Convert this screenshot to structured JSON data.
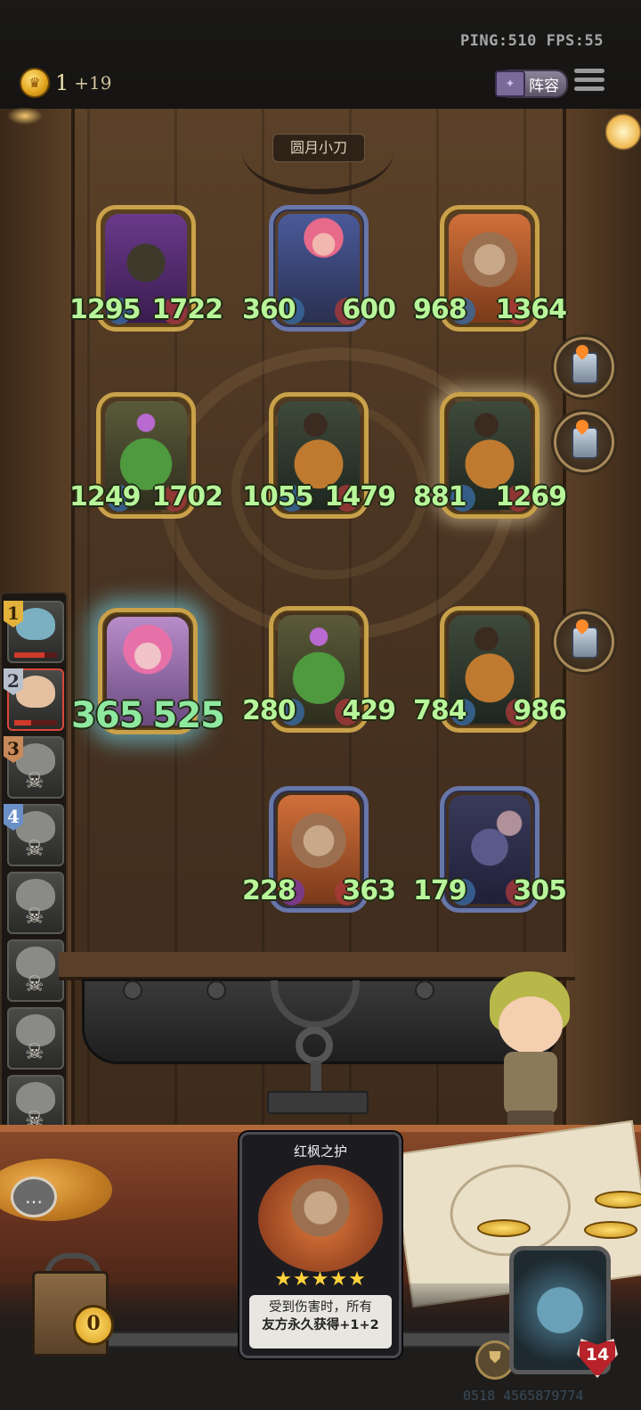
{
  "hud": {
    "ping": "PING:510",
    "fps": "FPS:55",
    "coins": "1",
    "coin_gain": "+19",
    "lineup_label": "阵容"
  },
  "opponent": {
    "name": "圆月小刀"
  },
  "board": {
    "units": [
      {
        "atk": "1295",
        "hp": "1722",
        "portrait": "dark-stump"
      },
      {
        "atk": "360",
        "hp": "600",
        "portrait": "armored-knight"
      },
      {
        "atk": "968",
        "hp": "1364",
        "portrait": "maple-treant"
      },
      {
        "atk": "1249",
        "hp": "1702",
        "portrait": "cactus"
      },
      {
        "atk": "1055",
        "hp": "1479",
        "portrait": "pumpkin"
      },
      {
        "atk": "881",
        "hp": "1269",
        "portrait": "pumpkin"
      },
      {
        "atk": "365",
        "hp": "525",
        "portrait": "pink-girl"
      },
      {
        "atk": "280",
        "hp": "429",
        "portrait": "cactus"
      },
      {
        "atk": "784",
        "hp": "986",
        "portrait": "pumpkin"
      },
      {
        "atk": "228",
        "hp": "363",
        "portrait": "maple-treant"
      },
      {
        "atk": "179",
        "hp": "305",
        "portrait": "rat"
      }
    ]
  },
  "roster": {
    "ranks": [
      "1",
      "2",
      "3",
      "4"
    ]
  },
  "card": {
    "title": "红枫之护",
    "stars": "★★★★★",
    "desc_line1": "受到伤害时，所有",
    "desc_line2": "友方永久获得+1+2"
  },
  "chest": {
    "count": "0"
  },
  "hero": {
    "hp": "14"
  },
  "footer": {
    "id": "0518 4565879774"
  },
  "colors": {
    "stat_text": "#b8f59a",
    "gold_frame": "#c9a14a",
    "silver_frame": "#6876a8",
    "active_slot": "#d8483a"
  }
}
